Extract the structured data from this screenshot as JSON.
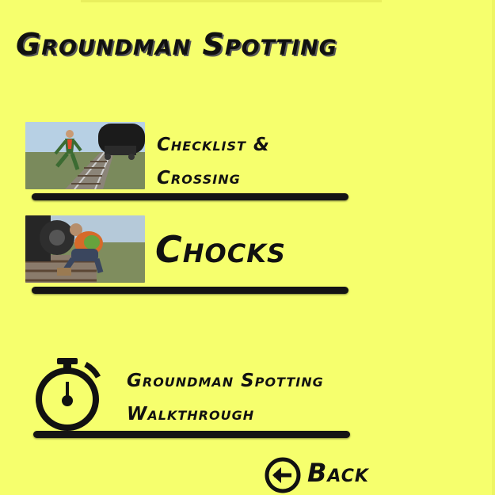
{
  "page": {
    "title": "Groundman Spotting"
  },
  "menu": {
    "items": [
      {
        "line1": "Checklist &",
        "line2": "Crossing",
        "thumb_icon": "groundman-crossing-tracks-image"
      },
      {
        "label": "Chocks",
        "thumb_icon": "groundman-placing-chock-image"
      },
      {
        "line1": "Groundman Spotting",
        "line2": "Walkthrough",
        "icon": "stopwatch-icon"
      }
    ]
  },
  "back": {
    "label": "Back",
    "icon": "back-arrow-circle-icon"
  },
  "colors": {
    "background": "#f6ff6d",
    "text": "#111111",
    "underline": "#141414"
  }
}
